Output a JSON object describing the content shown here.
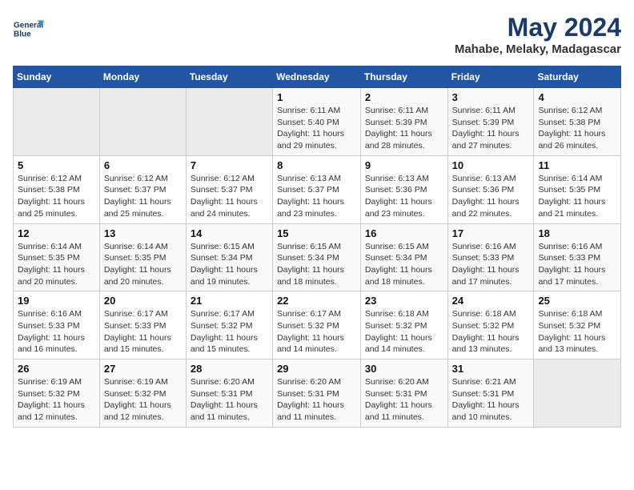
{
  "logo": {
    "line1": "General",
    "line2": "Blue"
  },
  "title": "May 2024",
  "location": "Mahabe, Melaky, Madagascar",
  "weekdays": [
    "Sunday",
    "Monday",
    "Tuesday",
    "Wednesday",
    "Thursday",
    "Friday",
    "Saturday"
  ],
  "weeks": [
    [
      {
        "day": "",
        "info": ""
      },
      {
        "day": "",
        "info": ""
      },
      {
        "day": "",
        "info": ""
      },
      {
        "day": "1",
        "info": "Sunrise: 6:11 AM\nSunset: 5:40 PM\nDaylight: 11 hours and 29 minutes."
      },
      {
        "day": "2",
        "info": "Sunrise: 6:11 AM\nSunset: 5:39 PM\nDaylight: 11 hours and 28 minutes."
      },
      {
        "day": "3",
        "info": "Sunrise: 6:11 AM\nSunset: 5:39 PM\nDaylight: 11 hours and 27 minutes."
      },
      {
        "day": "4",
        "info": "Sunrise: 6:12 AM\nSunset: 5:38 PM\nDaylight: 11 hours and 26 minutes."
      }
    ],
    [
      {
        "day": "5",
        "info": "Sunrise: 6:12 AM\nSunset: 5:38 PM\nDaylight: 11 hours and 25 minutes."
      },
      {
        "day": "6",
        "info": "Sunrise: 6:12 AM\nSunset: 5:37 PM\nDaylight: 11 hours and 25 minutes."
      },
      {
        "day": "7",
        "info": "Sunrise: 6:12 AM\nSunset: 5:37 PM\nDaylight: 11 hours and 24 minutes."
      },
      {
        "day": "8",
        "info": "Sunrise: 6:13 AM\nSunset: 5:37 PM\nDaylight: 11 hours and 23 minutes."
      },
      {
        "day": "9",
        "info": "Sunrise: 6:13 AM\nSunset: 5:36 PM\nDaylight: 11 hours and 23 minutes."
      },
      {
        "day": "10",
        "info": "Sunrise: 6:13 AM\nSunset: 5:36 PM\nDaylight: 11 hours and 22 minutes."
      },
      {
        "day": "11",
        "info": "Sunrise: 6:14 AM\nSunset: 5:35 PM\nDaylight: 11 hours and 21 minutes."
      }
    ],
    [
      {
        "day": "12",
        "info": "Sunrise: 6:14 AM\nSunset: 5:35 PM\nDaylight: 11 hours and 20 minutes."
      },
      {
        "day": "13",
        "info": "Sunrise: 6:14 AM\nSunset: 5:35 PM\nDaylight: 11 hours and 20 minutes."
      },
      {
        "day": "14",
        "info": "Sunrise: 6:15 AM\nSunset: 5:34 PM\nDaylight: 11 hours and 19 minutes."
      },
      {
        "day": "15",
        "info": "Sunrise: 6:15 AM\nSunset: 5:34 PM\nDaylight: 11 hours and 18 minutes."
      },
      {
        "day": "16",
        "info": "Sunrise: 6:15 AM\nSunset: 5:34 PM\nDaylight: 11 hours and 18 minutes."
      },
      {
        "day": "17",
        "info": "Sunrise: 6:16 AM\nSunset: 5:33 PM\nDaylight: 11 hours and 17 minutes."
      },
      {
        "day": "18",
        "info": "Sunrise: 6:16 AM\nSunset: 5:33 PM\nDaylight: 11 hours and 17 minutes."
      }
    ],
    [
      {
        "day": "19",
        "info": "Sunrise: 6:16 AM\nSunset: 5:33 PM\nDaylight: 11 hours and 16 minutes."
      },
      {
        "day": "20",
        "info": "Sunrise: 6:17 AM\nSunset: 5:33 PM\nDaylight: 11 hours and 15 minutes."
      },
      {
        "day": "21",
        "info": "Sunrise: 6:17 AM\nSunset: 5:32 PM\nDaylight: 11 hours and 15 minutes."
      },
      {
        "day": "22",
        "info": "Sunrise: 6:17 AM\nSunset: 5:32 PM\nDaylight: 11 hours and 14 minutes."
      },
      {
        "day": "23",
        "info": "Sunrise: 6:18 AM\nSunset: 5:32 PM\nDaylight: 11 hours and 14 minutes."
      },
      {
        "day": "24",
        "info": "Sunrise: 6:18 AM\nSunset: 5:32 PM\nDaylight: 11 hours and 13 minutes."
      },
      {
        "day": "25",
        "info": "Sunrise: 6:18 AM\nSunset: 5:32 PM\nDaylight: 11 hours and 13 minutes."
      }
    ],
    [
      {
        "day": "26",
        "info": "Sunrise: 6:19 AM\nSunset: 5:32 PM\nDaylight: 11 hours and 12 minutes."
      },
      {
        "day": "27",
        "info": "Sunrise: 6:19 AM\nSunset: 5:32 PM\nDaylight: 11 hours and 12 minutes."
      },
      {
        "day": "28",
        "info": "Sunrise: 6:20 AM\nSunset: 5:31 PM\nDaylight: 11 hours and 11 minutes."
      },
      {
        "day": "29",
        "info": "Sunrise: 6:20 AM\nSunset: 5:31 PM\nDaylight: 11 hours and 11 minutes."
      },
      {
        "day": "30",
        "info": "Sunrise: 6:20 AM\nSunset: 5:31 PM\nDaylight: 11 hours and 11 minutes."
      },
      {
        "day": "31",
        "info": "Sunrise: 6:21 AM\nSunset: 5:31 PM\nDaylight: 11 hours and 10 minutes."
      },
      {
        "day": "",
        "info": ""
      }
    ]
  ]
}
